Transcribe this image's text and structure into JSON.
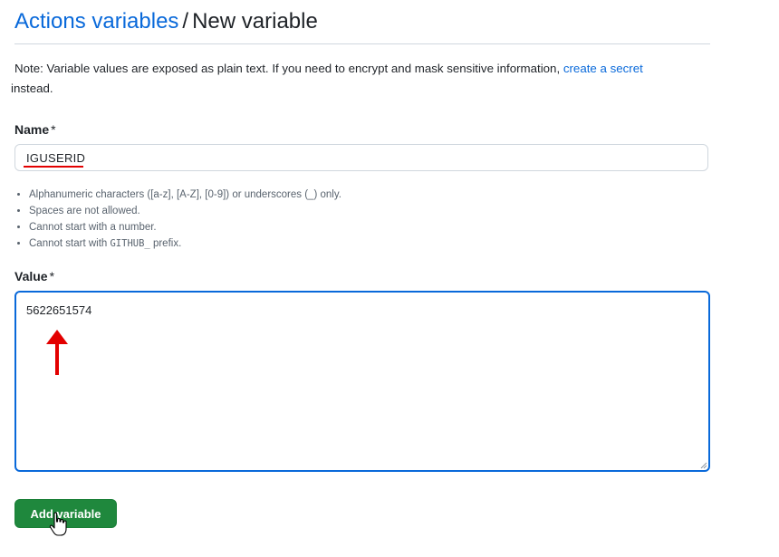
{
  "breadcrumb": {
    "parent_label": "Actions variables",
    "separator": "/",
    "current_label": "New variable"
  },
  "note": {
    "text_before": "Note: Variable values are exposed as plain text. If you need to encrypt and mask sensitive information, ",
    "link_label": "create a secret",
    "text_after": " instead."
  },
  "name_field": {
    "label": "Name",
    "required_mark": "*",
    "value": "IGUSERID"
  },
  "name_rules": [
    "Alphanumeric characters ([a-z], [A-Z], [0-9]) or underscores (_) only.",
    "Spaces are not allowed.",
    "Cannot start with a number."
  ],
  "name_rule_prefix": {
    "before": "Cannot start with ",
    "code": "GITHUB_",
    "after": " prefix."
  },
  "value_field": {
    "label": "Value",
    "required_mark": "*",
    "value": "5622651574"
  },
  "submit": {
    "label": "Add variable"
  },
  "colors": {
    "link": "#0969da",
    "primary_button": "#1f883d",
    "annotation": "#e30000",
    "focus_border": "#0969da"
  },
  "icons": {
    "annotation_arrow": "red-up-arrow-icon",
    "pointer": "hand-pointer-cursor-icon"
  }
}
